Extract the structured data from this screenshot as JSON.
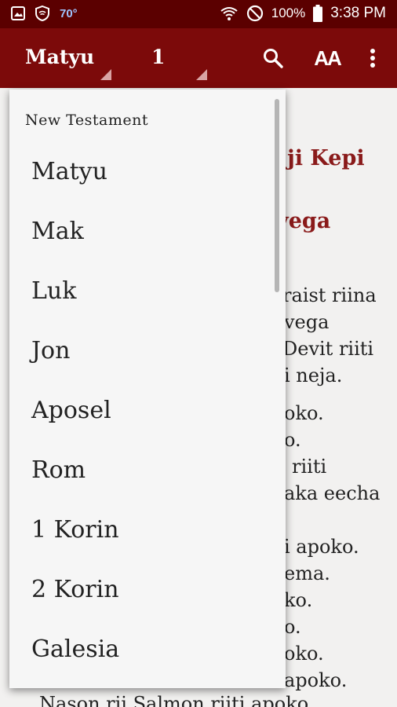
{
  "status_bar": {
    "temperature": "70°",
    "battery": "100%",
    "time": "3:38 PM"
  },
  "app_bar": {
    "book": "Matyu",
    "chapter": "1",
    "icons": [
      "search-icon",
      "text-size-icon",
      "more-vert-icon"
    ],
    "text_size_label": "AA"
  },
  "reader": {
    "heading_fragments": [
      "ji Kepi",
      "yega"
    ],
    "text_fragments": [
      "raist riina",
      "vega",
      "Devit riiti",
      "i neja.",
      "oko.",
      "o.",
      "riiti",
      "aka eecha",
      "i apoko.",
      "ema.",
      "ko.",
      "o.",
      "oko.",
      "apoko.",
      "Nason rii Salmon riiti apoko."
    ]
  },
  "dropdown": {
    "section_header": "New Testament",
    "items": [
      "Matyu",
      "Mak",
      "Luk",
      "Jon",
      "Aposel",
      "Rom",
      "1 Korin",
      "2 Korin",
      "Galesia"
    ]
  },
  "colors": {
    "status_bar": "#5b0000",
    "app_bar": "#7c0a0a",
    "heading": "#8a1a1a"
  }
}
